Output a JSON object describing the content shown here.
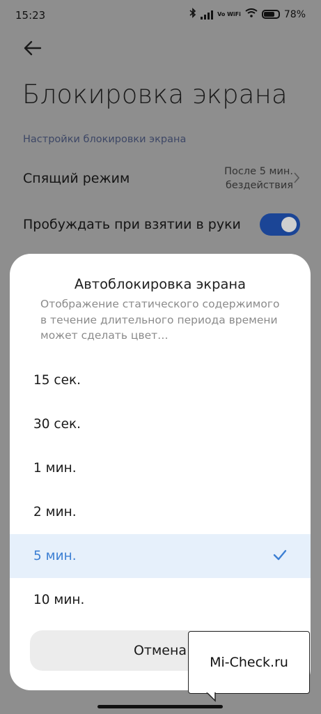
{
  "status_bar": {
    "time": "15:23",
    "network": "Vo WiFi",
    "battery": "78%"
  },
  "header": {
    "title": "Блокировка экрана"
  },
  "settings": {
    "section_label": "Настройки блокировки экрана",
    "sleep": {
      "label": "Спящий режим",
      "value_line1": "После 5 мин.",
      "value_line2": "бездействия"
    },
    "wake_on_lift": {
      "label": "Пробуждать при взятии в руки",
      "enabled": true
    }
  },
  "dialog": {
    "title": "Автоблокировка экрана",
    "description": "Отображение статического содержимого в течение длительного периода времени может сделать цвет…",
    "options": [
      "15 сек.",
      "30 сек.",
      "1 мин.",
      "2 мин.",
      "5 мин.",
      "10 мин."
    ],
    "selected": "5 мин.",
    "cancel_label": "Отмена"
  },
  "watermark": {
    "text": "Mi-Check.ru"
  },
  "colors": {
    "accent": "#3c7fd3",
    "toggle_on": "#1b4596",
    "selected_bg": "#e6f0fb",
    "dim_bg": "#8e8e8e"
  }
}
